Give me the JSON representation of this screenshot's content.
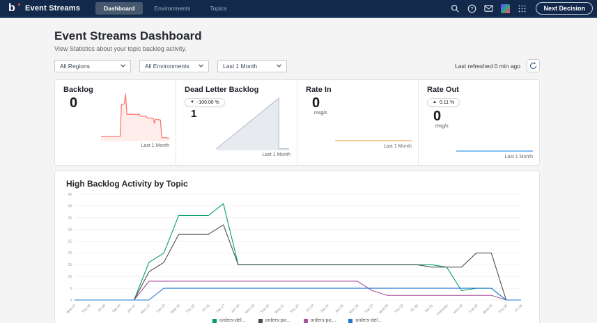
{
  "navbar": {
    "logo_text": "b",
    "brand": "Event Streams",
    "tabs": [
      {
        "label": "Dashboard",
        "active": true
      },
      {
        "label": "Environments",
        "active": false
      },
      {
        "label": "Topics",
        "active": false
      }
    ],
    "icons": {
      "search": "magnifier",
      "help": "question-circle",
      "mail": "envelope",
      "avatar": "user-avatar",
      "apps": "grid-dots"
    },
    "next_button": "Next Decision"
  },
  "header": {
    "title": "Event Streams Dashboard",
    "subtitle": "View Statistics about your topic backlog activity."
  },
  "filters": {
    "region": "All Regions",
    "environment": "All Environments",
    "time_range": "Last 1 Month",
    "last_refreshed": "Last refreshed 0 min ago"
  },
  "stats": {
    "cards": [
      {
        "title": "Backlog",
        "value": "0",
        "caption": "Last 1 Month"
      },
      {
        "title": "Dead Letter Backlog",
        "badge": {
          "arrow": "▼",
          "text": "-100.00 %"
        },
        "value": "1",
        "caption": "Last 1 Month"
      },
      {
        "title": "Rate In",
        "value": "0",
        "unit": "msg/s",
        "caption": "Last 1 Month"
      },
      {
        "title": "Rate Out",
        "badge": {
          "arrow": "▲",
          "text": "0.11 %"
        },
        "value": "0",
        "unit": "msg/s",
        "caption": "Last 1 Month"
      }
    ]
  },
  "chart_data": [
    {
      "id": "high-backlog-activity",
      "type": "line",
      "title": "High Backlog Activity by Topic",
      "xlabel": "",
      "ylabel": "",
      "ylim": [
        0,
        45
      ],
      "ytick_step": 5,
      "grid": true,
      "legend_position": "bottom",
      "categories": [
        "Wed 07",
        "Thu 08",
        "Fri 09",
        "Sat 10",
        "Jan 11",
        "Mon 12",
        "Tue 13",
        "Wed 14",
        "Thu 15",
        "Fri 16",
        "Sat 17",
        "Jan 18",
        "Mon 19",
        "Tue 20",
        "Wed 21",
        "Thu 22",
        "Fri 23",
        "Sat 24",
        "Jan 25",
        "Mon 26",
        "Tue 27",
        "Wed 28",
        "Thu 29",
        "Fri 30",
        "Sat 31",
        "February",
        "Mon 02",
        "Tue 03",
        "Wed 04",
        "Thu 05",
        "Fri 06"
      ],
      "series": [
        {
          "name": "orders-del...",
          "color": "#00a05f",
          "values": [
            0,
            0,
            0,
            0,
            0,
            16,
            20,
            36,
            36,
            36,
            41,
            15,
            15,
            15,
            15,
            15,
            15,
            15,
            15,
            15,
            15,
            15,
            15,
            15,
            15,
            14,
            4,
            5,
            5,
            0,
            0
          ]
        },
        {
          "name": "orders-pic...",
          "color": "#4d4d4d",
          "values": [
            0,
            0,
            0,
            0,
            0,
            12,
            16,
            28,
            28,
            28,
            32,
            15,
            15,
            15,
            15,
            15,
            15,
            15,
            15,
            15,
            15,
            15,
            15,
            15,
            14,
            14,
            14,
            20,
            20,
            0,
            0
          ]
        },
        {
          "name": "orders-pic...",
          "color": "#a8549e",
          "values": [
            0,
            0,
            0,
            0,
            0,
            8,
            8,
            8,
            8,
            8,
            8,
            8,
            8,
            8,
            8,
            8,
            8,
            8,
            8,
            8,
            4,
            2,
            2,
            2,
            2,
            2,
            2,
            2,
            2,
            0,
            0
          ]
        },
        {
          "name": "orders-del...",
          "color": "#1f79d4",
          "values": [
            0,
            0,
            0,
            0,
            0,
            0,
            5,
            5,
            5,
            5,
            5,
            5,
            5,
            5,
            5,
            5,
            5,
            5,
            5,
            5,
            5,
            5,
            5,
            5,
            5,
            5,
            5,
            5,
            5,
            0,
            0
          ]
        }
      ]
    },
    {
      "id": "backlog-spark",
      "type": "area",
      "color": "#fa7268",
      "fill": "rgba(250,114,104,0.13)",
      "points": [
        [
          0,
          10
        ],
        [
          28,
          10
        ],
        [
          30,
          78
        ],
        [
          33,
          78
        ],
        [
          34,
          80
        ],
        [
          36,
          100
        ],
        [
          38,
          57
        ],
        [
          56,
          57
        ],
        [
          58,
          53
        ],
        [
          66,
          53
        ],
        [
          68,
          49
        ],
        [
          75,
          49
        ],
        [
          77,
          47
        ],
        [
          78,
          38
        ],
        [
          80,
          47
        ],
        [
          87,
          45
        ],
        [
          89,
          8
        ],
        [
          100,
          7
        ]
      ]
    },
    {
      "id": "dead-letter-spark",
      "type": "area",
      "color": "#b8c2cd",
      "fill": "#e7ebf0",
      "points": [
        [
          5,
          3
        ],
        [
          85,
          96
        ],
        [
          85,
          3
        ],
        [
          98,
          3
        ]
      ]
    },
    {
      "id": "rate-in-spark",
      "type": "line",
      "color": "#f2a854",
      "points": [
        [
          0,
          50
        ],
        [
          100,
          50
        ]
      ]
    },
    {
      "id": "rate-out-spark",
      "type": "line",
      "color": "#3f97e8",
      "points": [
        [
          0,
          50
        ],
        [
          100,
          50
        ]
      ]
    }
  ]
}
